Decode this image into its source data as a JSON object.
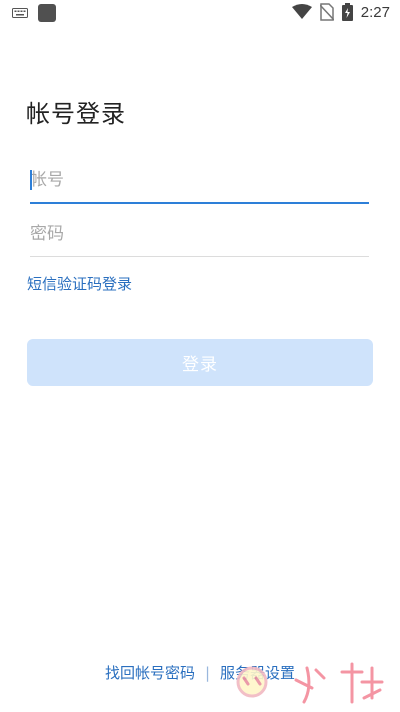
{
  "status_bar": {
    "time": "2:27",
    "icons": [
      "keyboard-icon",
      "app-icon",
      "wifi-icon",
      "no-sim-icon",
      "battery-charging-icon"
    ]
  },
  "page": {
    "title": "帐号登录"
  },
  "form": {
    "account_placeholder": "帐号",
    "account_value": "",
    "password_placeholder": "密码",
    "password_value": "",
    "sms_login_label": "短信验证码登录",
    "login_button_label": "登录"
  },
  "footer": {
    "recover_label": "找回帐号密码",
    "separator": "|",
    "server_settings_label": "服务器设置"
  },
  "colors": {
    "accent": "#2d7fd8",
    "link": "#2a6fbf",
    "button_disabled_bg": "#cfe3fb",
    "divider": "#dcdcdc"
  }
}
